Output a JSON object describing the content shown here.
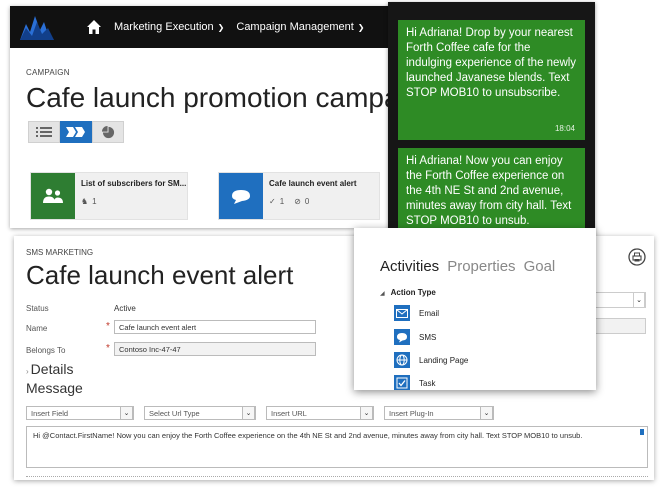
{
  "nav": {
    "menu1": "Marketing Execution",
    "menu2": "Campaign Management"
  },
  "campaign": {
    "crumb": "CAMPAIGN",
    "title": "Cafe launch promotion campaign",
    "cards": [
      {
        "title": "List of subscribers for SM...",
        "count": "1",
        "color": "#2e7d32"
      },
      {
        "title": "Cafe launch event alert",
        "check_count": "1",
        "block_count": "0",
        "color": "#1f6fbf"
      }
    ]
  },
  "sms": {
    "bubble1": "Hi Adriana! Drop by your nearest Forth Coffee cafe for the indulging experience of the newly launched Javanese blends. Text STOP MOB10 to unsubscribe.",
    "bubble1_time": "18:04",
    "bubble2": "Hi Adriana! Now you can enjoy the Forth Coffee experience on the 4th NE St and 2nd avenue, minutes away from city hall. Text STOP MOB10 to unsub."
  },
  "form": {
    "crumb": "SMS MARKETING",
    "title": "Cafe launch event alert",
    "status_label": "Status",
    "status_value": "Active",
    "name_label": "Name",
    "name_value": "Cafe launch event alert",
    "belongs_label": "Belongs To",
    "belongs_value": "Contoso Inc-47-47",
    "details": "Details",
    "message": "Message",
    "dropdowns": [
      "Insert Field",
      "Select Url Type",
      "Insert URL",
      "Insert Plug-In"
    ],
    "message_text": "Hi @Contact.FirstName! Now you can enjoy the Forth Coffee experience on the 4th NE St and 2nd avenue, minutes away from city hall. Text STOP MOB10 to unsub."
  },
  "panel": {
    "tabs": [
      "Activities",
      "Properties",
      "Goal"
    ],
    "group": "Action Type",
    "items": [
      "Email",
      "SMS",
      "Landing Page",
      "Task"
    ]
  },
  "colors": {
    "accent": "#1f6fbf",
    "sms_green": "#2e8b25",
    "nav_bg": "#111111"
  }
}
